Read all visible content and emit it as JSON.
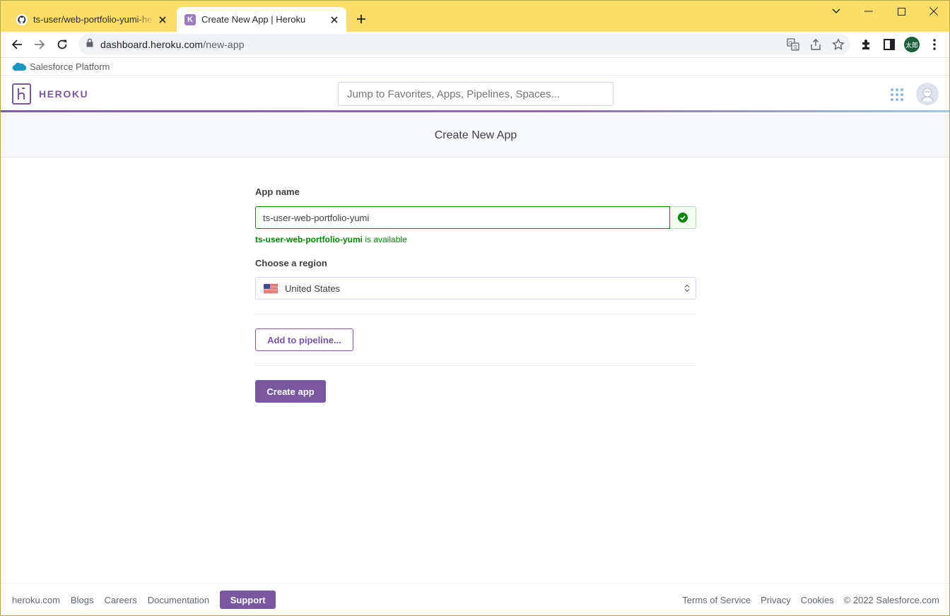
{
  "browser": {
    "tabs": [
      {
        "title": "ts-user/web-portfolio-yumi-heroku",
        "favicon": "github-icon",
        "active": false
      },
      {
        "title": "Create New App | Heroku",
        "favicon": "heroku-icon",
        "active": true
      }
    ],
    "url_host": "dashboard.heroku.com",
    "url_path": "/new-app",
    "profile_label": "太郎"
  },
  "salesforce_bar": {
    "label": "Salesforce Platform"
  },
  "header": {
    "logo_text": "HEROKU",
    "search_placeholder": "Jump to Favorites, Apps, Pipelines, Spaces..."
  },
  "page": {
    "title": "Create New App"
  },
  "form": {
    "app_name_label": "App name",
    "app_name_value": "ts-user-web-portfolio-yumi",
    "availability_name": "ts-user-web-portfolio-yumi",
    "availability_suffix": " is available",
    "region_label": "Choose a region",
    "region_value": "United States",
    "pipeline_button": "Add to pipeline...",
    "create_button": "Create app"
  },
  "footer": {
    "left_links": [
      "heroku.com",
      "Blogs",
      "Careers",
      "Documentation"
    ],
    "support_label": "Support",
    "right_links": [
      "Terms of Service",
      "Privacy",
      "Cookies"
    ],
    "copyright": "© 2022 Salesforce.com"
  },
  "colors": {
    "heroku_purple": "#79589f",
    "success_green": "#008700",
    "tabstrip_yellow": "#fcdd6a"
  }
}
